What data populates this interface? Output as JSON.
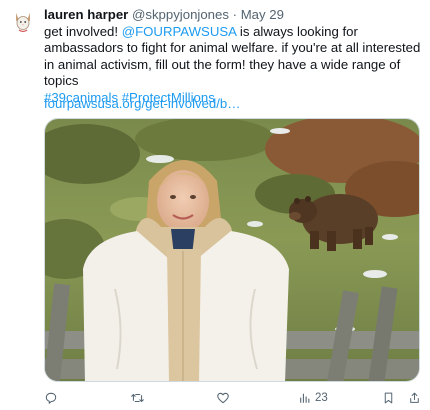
{
  "tweet": {
    "author_name": "lauren harper",
    "author_handle": "@skppyjonjones",
    "separator": "·",
    "date": "May 29",
    "text_part1": "get involved! ",
    "mention": "@FOURPAWSUSA",
    "text_part2": " is always looking for ambassadors to fight for animal welfare. if you're at all interested in animal activism, fill out the form! they have a wide range of topics",
    "hashtag1": "#39canimals",
    "hashtag2": "#ProtectMillions",
    "url": "fourpawsusa.org/get-involved/b…",
    "views": "23"
  },
  "icons": {
    "avatar": "cat-avatar-icon",
    "reply": "reply-icon",
    "retweet": "retweet-icon",
    "like": "heart-icon",
    "views": "views-chart-icon",
    "bookmark": "bookmark-icon",
    "share": "share-icon"
  },
  "colors": {
    "link": "#1d9bf0",
    "secondary_text": "#536471"
  }
}
